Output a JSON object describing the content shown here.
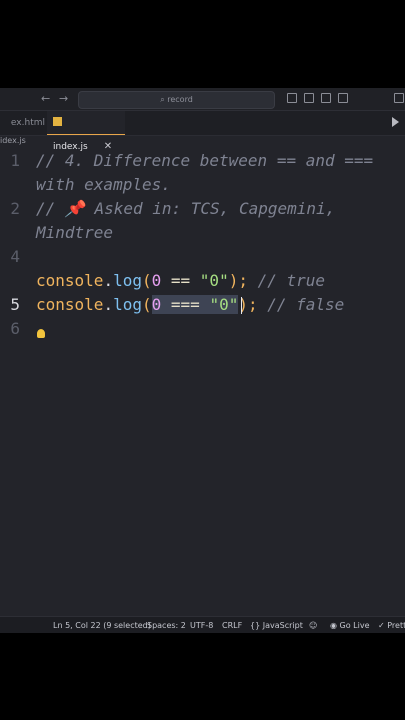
{
  "title_bar": {
    "search_text": "record",
    "search_icon": "search-icon"
  },
  "tabs": [
    {
      "label": "ex.html",
      "active": false
    },
    {
      "label": "index.js",
      "active": true,
      "close_symbol": "✕"
    }
  ],
  "breadcrumb": "idex.js",
  "editor": {
    "line_numbers": [
      "1",
      "2",
      "4",
      "5",
      "6"
    ],
    "current_line": "5",
    "lines": {
      "l1a": "// 4. Difference between == and ===",
      "l1b": "with examples.",
      "l2a": "// 📌 Asked in: TCS, Capgemini,",
      "l2b": "Mindtree",
      "l4_console": "console",
      "l4_dot": ".",
      "l4_log": "log",
      "l4_open": "(",
      "l4_zero": "0",
      "l4_op": " == ",
      "l4_str": "\"0\"",
      "l4_close": ");",
      "l4_comment": " // true",
      "l5_console": "console",
      "l5_dot": ".",
      "l5_log": "log",
      "l5_open": "(",
      "l5_zero": "0",
      "l5_op": " === ",
      "l5_str": "\"0\"",
      "l5_close": ");",
      "l5_comment": " // false"
    }
  },
  "status_bar": {
    "position": "Ln 5, Col 22 (9 selected)",
    "spaces": "Spaces: 2",
    "encoding": "UTF-8",
    "eol": "CRLF",
    "language": "{} JavaScript",
    "go_live": "Go Live",
    "prettier": "✓ Prett"
  },
  "colors": {
    "editor_bg": "#23242a",
    "keyword": "#f0b45e",
    "function": "#7ec0f0",
    "number": "#e6a0f0",
    "string": "#a6de82",
    "comment": "#7f8392"
  }
}
